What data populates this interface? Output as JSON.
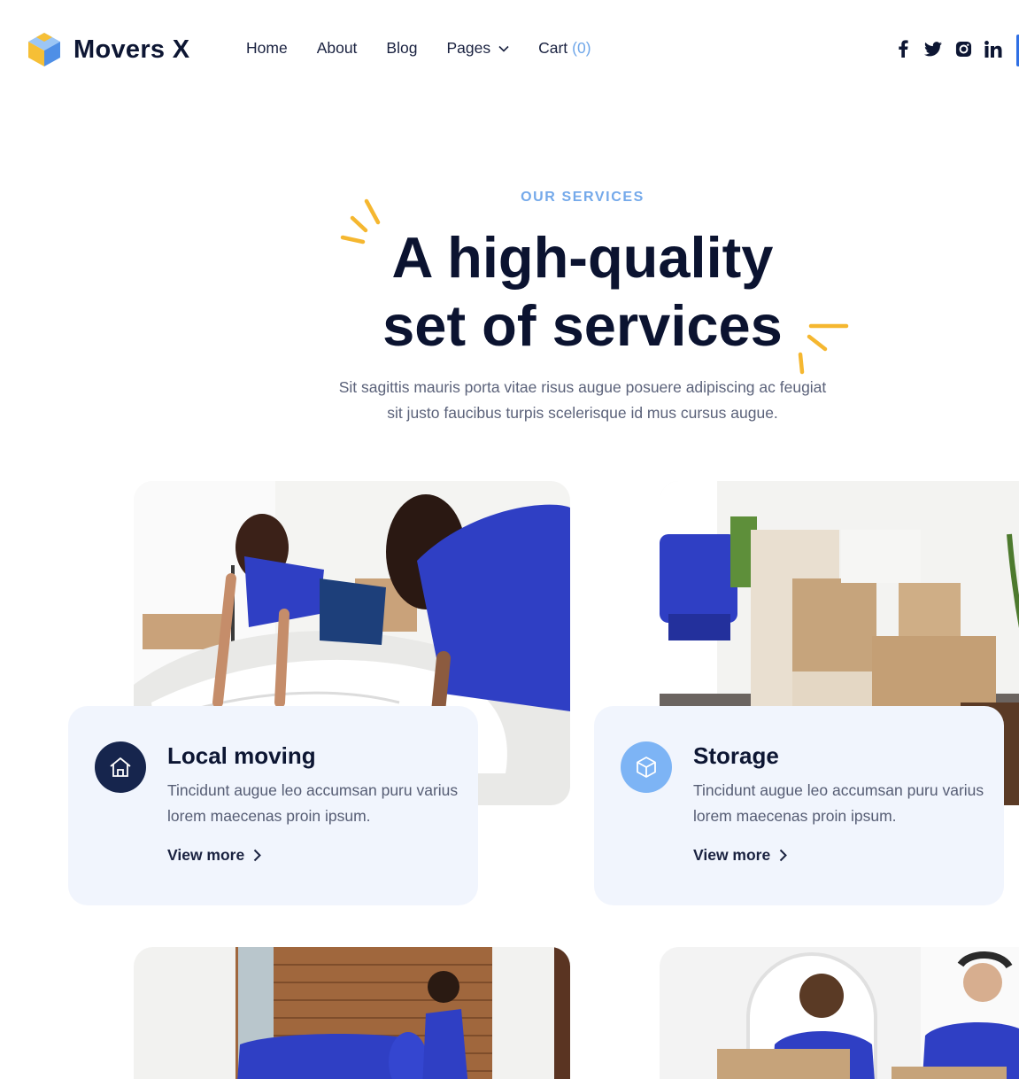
{
  "brand": {
    "name": "Movers X"
  },
  "nav": {
    "items": [
      {
        "label": "Home"
      },
      {
        "label": "About"
      },
      {
        "label": "Blog"
      },
      {
        "label": "Pages"
      }
    ],
    "cart_label": "Cart",
    "cart_count": "(0)"
  },
  "social": [
    "facebook-icon",
    "twitter-icon",
    "instagram-icon",
    "linkedin-icon"
  ],
  "hero": {
    "eyebrow": "OUR SERVICES",
    "headline_line1": "A high-quality",
    "headline_line2": "set of services",
    "sub_line1": "Sit sagittis mauris porta vitae risus augue posuere adipiscing ac feugiat",
    "sub_line2": "sit justo faucibus turpis scelerisque id mus cursus augue."
  },
  "services": [
    {
      "title": "Local moving",
      "desc": "Tincidunt augue leo accumsan puru varius lorem maecenas proin ipsum.",
      "link": "View more",
      "icon": "home-icon",
      "icon_bg": "#16254d"
    },
    {
      "title": "Storage",
      "desc": "Tincidunt augue leo accumsan puru varius lorem maecenas proin ipsum.",
      "link": "View more",
      "icon": "box-icon",
      "icon_bg": "#7db4f5"
    }
  ],
  "colors": {
    "accent": "#74a9ea",
    "navy": "#0b1330",
    "card_bg": "#f1f5fd",
    "spark": "#f5b730",
    "uniform_blue": "#2f3fc4"
  }
}
